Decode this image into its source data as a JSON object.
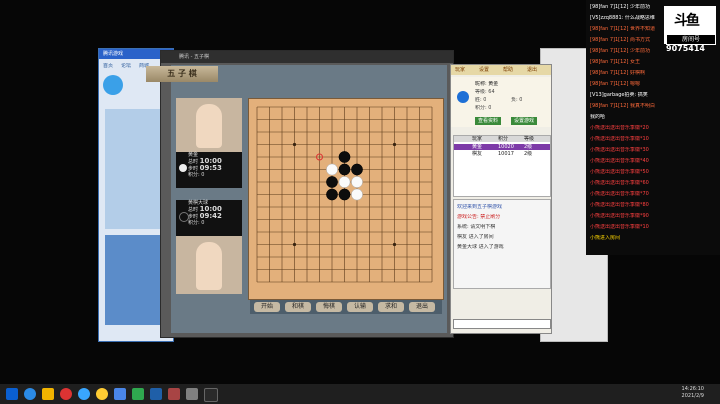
{
  "stream": {
    "room_logo_text": "房间号",
    "room_id": "9075414",
    "chat_lines": [
      {
        "text": "[98]fan 7]1[12] 少年前功",
        "color": "#ffffff"
      },
      {
        "text": "[V5]zzq8881: 什么战略思维",
        "color": "#ffffff"
      },
      {
        "text": "[98]fan 7]1[12] 世界不知道",
        "color": "#ff6a3a"
      },
      {
        "text": "[98]fan 7]1[12] 尚书方式",
        "color": "#ff6a3a"
      },
      {
        "text": "[98]fan 7]1[12] 少年前功",
        "color": "#ff6a3a"
      },
      {
        "text": "[98]fan 7]1[12] 女王",
        "color": "#ff6a3a"
      },
      {
        "text": "[98]fan 7]1[12] 好棋啊",
        "color": "#ff6a3a"
      },
      {
        "text": "[98]fan 7]1[12] 嗯嗯",
        "color": "#ff6a3a"
      },
      {
        "text": "[V13]garbage拍卖: 搞笑",
        "color": "#ffffff"
      },
      {
        "text": "[98]fan 7]1[12] 我真不明白",
        "color": "#ff6a3a"
      },
      {
        "text": "我的哈",
        "color": "#ffffff"
      },
      {
        "text": "小熊送出送出音乐季徽*20",
        "color": "#ff4040"
      },
      {
        "text": "小熊送出送出音乐季徽*10",
        "color": "#ff4040"
      },
      {
        "text": "小熊送出送出音乐季徽*30",
        "color": "#ff4040"
      },
      {
        "text": "小熊送出送出音乐季徽*40",
        "color": "#ff4040"
      },
      {
        "text": "小熊送出送出音乐季徽*50",
        "color": "#ff4040"
      },
      {
        "text": "小熊送出送出音乐季徽*60",
        "color": "#ff4040"
      },
      {
        "text": "小熊送出送出音乐季徽*70",
        "color": "#ff4040"
      },
      {
        "text": "小熊送出送出音乐季徽*80",
        "color": "#ff4040"
      },
      {
        "text": "小熊送出送出音乐季徽*90",
        "color": "#ff4040"
      },
      {
        "text": "小熊送出送出音乐季徽*10",
        "color": "#ff4040"
      },
      {
        "text": "小熊进入房间",
        "color": "#ffd700"
      }
    ]
  },
  "lobby": {
    "title": "腾讯游戏",
    "tabs": [
      "首页",
      "论坛",
      "商城"
    ]
  },
  "game": {
    "window_title": "腾讯 - 五子棋",
    "banner": "五 子 棋",
    "player1": {
      "name": "黄金",
      "total_time": "10:00",
      "move_time": "09:53",
      "score": "积分: 0",
      "stone": "white"
    },
    "player2": {
      "name": "黄棋大球",
      "total_time": "10:00",
      "move_time": "09:42",
      "score": "积分: 0",
      "stone": "black"
    },
    "labels": {
      "total": "总时",
      "move": "步时"
    },
    "buttons": [
      "开始",
      "和棋",
      "悔棋",
      "认输",
      "求和",
      "退出"
    ],
    "board_size": 15,
    "stones": [
      {
        "col": 7,
        "row": 4,
        "color": "black"
      },
      {
        "col": 6,
        "row": 5,
        "color": "white"
      },
      {
        "col": 7,
        "row": 5,
        "color": "black"
      },
      {
        "col": 8,
        "row": 5,
        "color": "black"
      },
      {
        "col": 6,
        "row": 6,
        "color": "black"
      },
      {
        "col": 7,
        "row": 6,
        "color": "white"
      },
      {
        "col": 8,
        "row": 6,
        "color": "white"
      },
      {
        "col": 6,
        "row": 7,
        "color": "black"
      },
      {
        "col": 7,
        "row": 7,
        "color": "black"
      },
      {
        "col": 8,
        "row": 7,
        "color": "white"
      }
    ],
    "last_move": {
      "col": 5,
      "row": 4
    }
  },
  "side": {
    "tabs": [
      "玩家",
      "设置",
      "帮助",
      "退出"
    ],
    "user_name": "昵称: 黄金",
    "user_stats": [
      "等级: 64",
      "胜: 0",
      "负: 0",
      "积分: 0"
    ],
    "buttons": [
      "查看资料",
      "设置游戏"
    ],
    "list_header": [
      "",
      "玩家",
      "积分",
      "等级"
    ],
    "list_rows": [
      {
        "cells": [
          "",
          "黄金",
          "10020",
          "2级"
        ],
        "selected": true
      },
      {
        "cells": [
          "",
          "棋友",
          "10017",
          "2级"
        ],
        "selected": false
      }
    ],
    "chat_lines": [
      {
        "text": "欢迎来到五子棋游戏",
        "color": "#3355aa"
      },
      {
        "text": "游戏公告: 禁止刷分",
        "color": "#cc2222"
      },
      {
        "text": "系统: 请文明下棋",
        "color": "#333333"
      },
      {
        "text": "棋友 进入了房间",
        "color": "#333333"
      },
      {
        "text": "黄金大球 进入了游戏",
        "color": "#333333"
      }
    ]
  },
  "taskbar": {
    "time": "14:26:10",
    "date": "2021/2/9"
  }
}
